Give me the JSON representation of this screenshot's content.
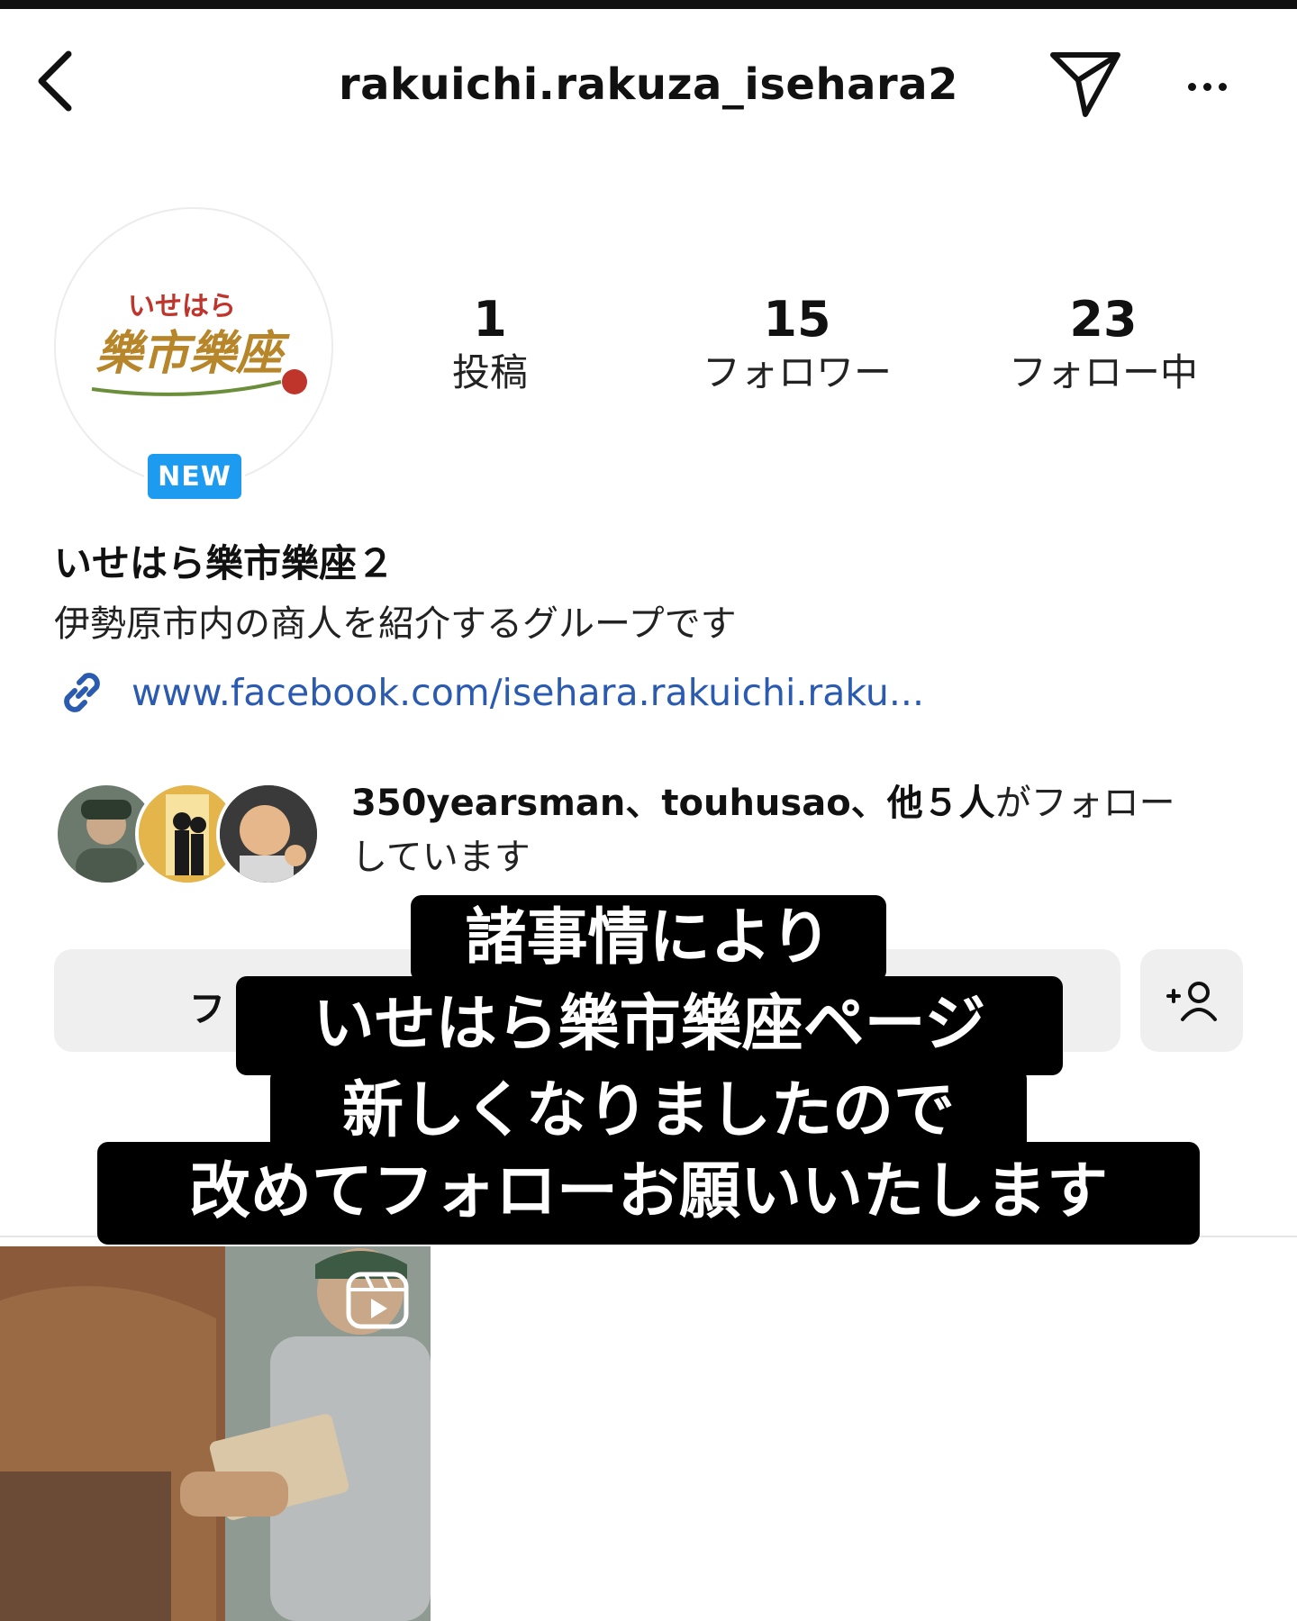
{
  "header": {
    "username": "rakuichi.rakuza_isehara2"
  },
  "profile": {
    "logo_text_top": "いせはら",
    "logo_text_main": "樂市樂座",
    "new_badge": "NEW",
    "stats": [
      {
        "value": "1",
        "label": "投稿"
      },
      {
        "value": "15",
        "label": "フォロワー"
      },
      {
        "value": "23",
        "label": "フォロー中"
      }
    ],
    "display_name": "いせはら樂市樂座２",
    "bio": "伊勢原市内の商人を紹介するグループです",
    "link": "www.facebook.com/isehara.rakuichi.raku..."
  },
  "mutual": {
    "names": "350yearsman、touhusao、他５人",
    "suffix_line1": "がフォロー",
    "suffix_line2": "しています"
  },
  "actions": {
    "follow_label_partial": "フ"
  },
  "highlight_hint": "...",
  "caption": {
    "line1": "諸事情により",
    "line2": "いせはら樂市樂座ページ",
    "line3": "新しくなりましたので",
    "line4": "改めてフォローお願いいたします"
  },
  "colors": {
    "new_badge": "#1d9bf0",
    "link": "#2b5bb0",
    "button_bg": "#efefef"
  }
}
